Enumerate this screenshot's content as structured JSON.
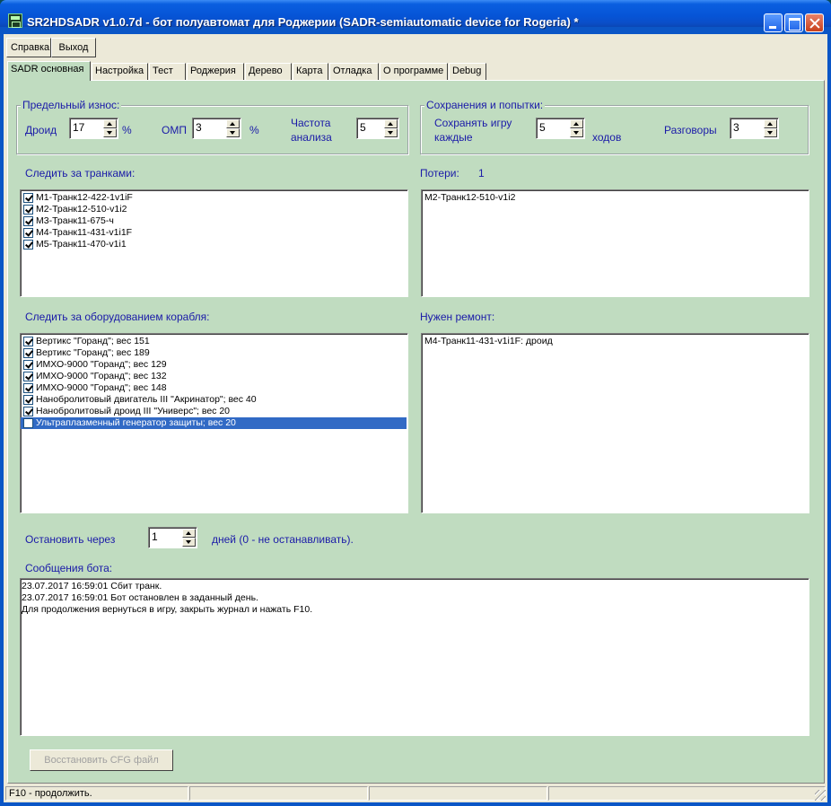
{
  "window": {
    "title": "SR2HDSADR  v1.0.7d - бот полуавтомат для Роджерии (SADR-semiautomatic device for Rogeria)   *"
  },
  "menu": {
    "help": "Справка",
    "exit": "Выход"
  },
  "tabs": [
    "SADR основная",
    "Настройка",
    "Тест",
    "Роджерия",
    "Дерево",
    "Карта",
    "Отладка",
    "О программе",
    "Debug"
  ],
  "wear": {
    "title": "Предельный износ:",
    "droid_label": "Дроид",
    "droid_value": "17",
    "droid_unit": "%",
    "omp_label": "ОМП",
    "omp_value": "3",
    "omp_unit": "%",
    "freq_label_1": "Частота",
    "freq_label_2": "анализа",
    "freq_value": "5"
  },
  "saves": {
    "title": "Сохранения и попытки:",
    "save_label_1": "Сохранять игру",
    "save_label_2": "каждые",
    "save_value": "5",
    "save_unit": "ходов",
    "talks_label": "Разговоры",
    "talks_value": "3"
  },
  "tranks": {
    "label": "Следить за транками:",
    "items": [
      {
        "text": "M1-Транк12-422-1v1iF",
        "checked": true
      },
      {
        "text": "M2-Транк12-510-v1i2",
        "checked": true
      },
      {
        "text": "M3-Транк11-675-ч",
        "checked": true
      },
      {
        "text": "M4-Транк11-431-v1i1F",
        "checked": true
      },
      {
        "text": "M5-Транк11-470-v1i1",
        "checked": true
      }
    ]
  },
  "losses": {
    "label": "Потери:",
    "count": "1",
    "items": [
      "M2-Транк12-510-v1i2"
    ]
  },
  "equipment": {
    "label": "Следить за оборудованием корабля:",
    "items": [
      {
        "text": "Вертикс \"Горанд\"; вес 151",
        "checked": true
      },
      {
        "text": "Вертикс \"Горанд\"; вес 189",
        "checked": true
      },
      {
        "text": "ИМХО-9000 \"Горанд\"; вес 129",
        "checked": true
      },
      {
        "text": "ИМХО-9000 \"Горанд\"; вес 132",
        "checked": true
      },
      {
        "text": "ИМХО-9000 \"Горанд\"; вес 148",
        "checked": true
      },
      {
        "text": "Нанобролитовый двигатель III \"Акринатор\"; вес 40",
        "checked": true
      },
      {
        "text": "Нанобролитовый дроид III \"Универс\"; вес 20",
        "checked": true
      },
      {
        "text": "Ультраплазменный генератор защиты; вес 20",
        "checked": false,
        "selected": true
      }
    ]
  },
  "repair": {
    "label": "Нужен ремонт:",
    "items": [
      "M4-Транк11-431-v1i1F: дроид"
    ]
  },
  "stop": {
    "label": "Остановить через",
    "value": "1",
    "suffix": "дней (0 - не останавливать)."
  },
  "log": {
    "label": "Сообщения бота:",
    "lines": [
      "23.07.2017 16:59:01 Сбит транк.",
      "23.07.2017 16:59:01 Бот остановлен в заданный день.",
      "Для продолжения вернуться в игру, закрыть журнал и нажать F10."
    ]
  },
  "restore_button": "Восстановить CFG файл",
  "status": {
    "text": "F10 - продолжить."
  }
}
